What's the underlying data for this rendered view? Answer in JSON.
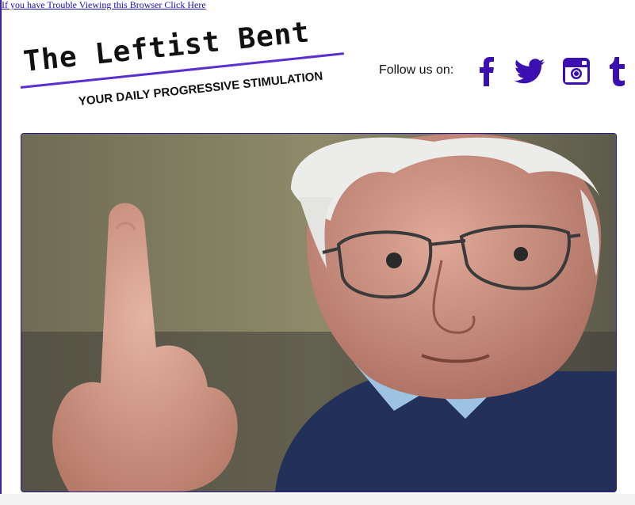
{
  "top_link": {
    "text": "If you have Trouble Viewing this Browser Click Here"
  },
  "logo": {
    "title": "The Leftist Bent",
    "tagline": "YOUR DAILY PROGRESSIVE STIMULATION"
  },
  "social": {
    "label": "Follow us on:",
    "icons": [
      "facebook-icon",
      "twitter-icon",
      "instagram-icon",
      "tumblr-icon"
    ],
    "color": "#3b0fb0"
  },
  "hero": {
    "description_icon": "photo"
  },
  "colors": {
    "accent": "#5a2fcf",
    "link": "#1a0dab",
    "border": "#2a1a8a"
  }
}
